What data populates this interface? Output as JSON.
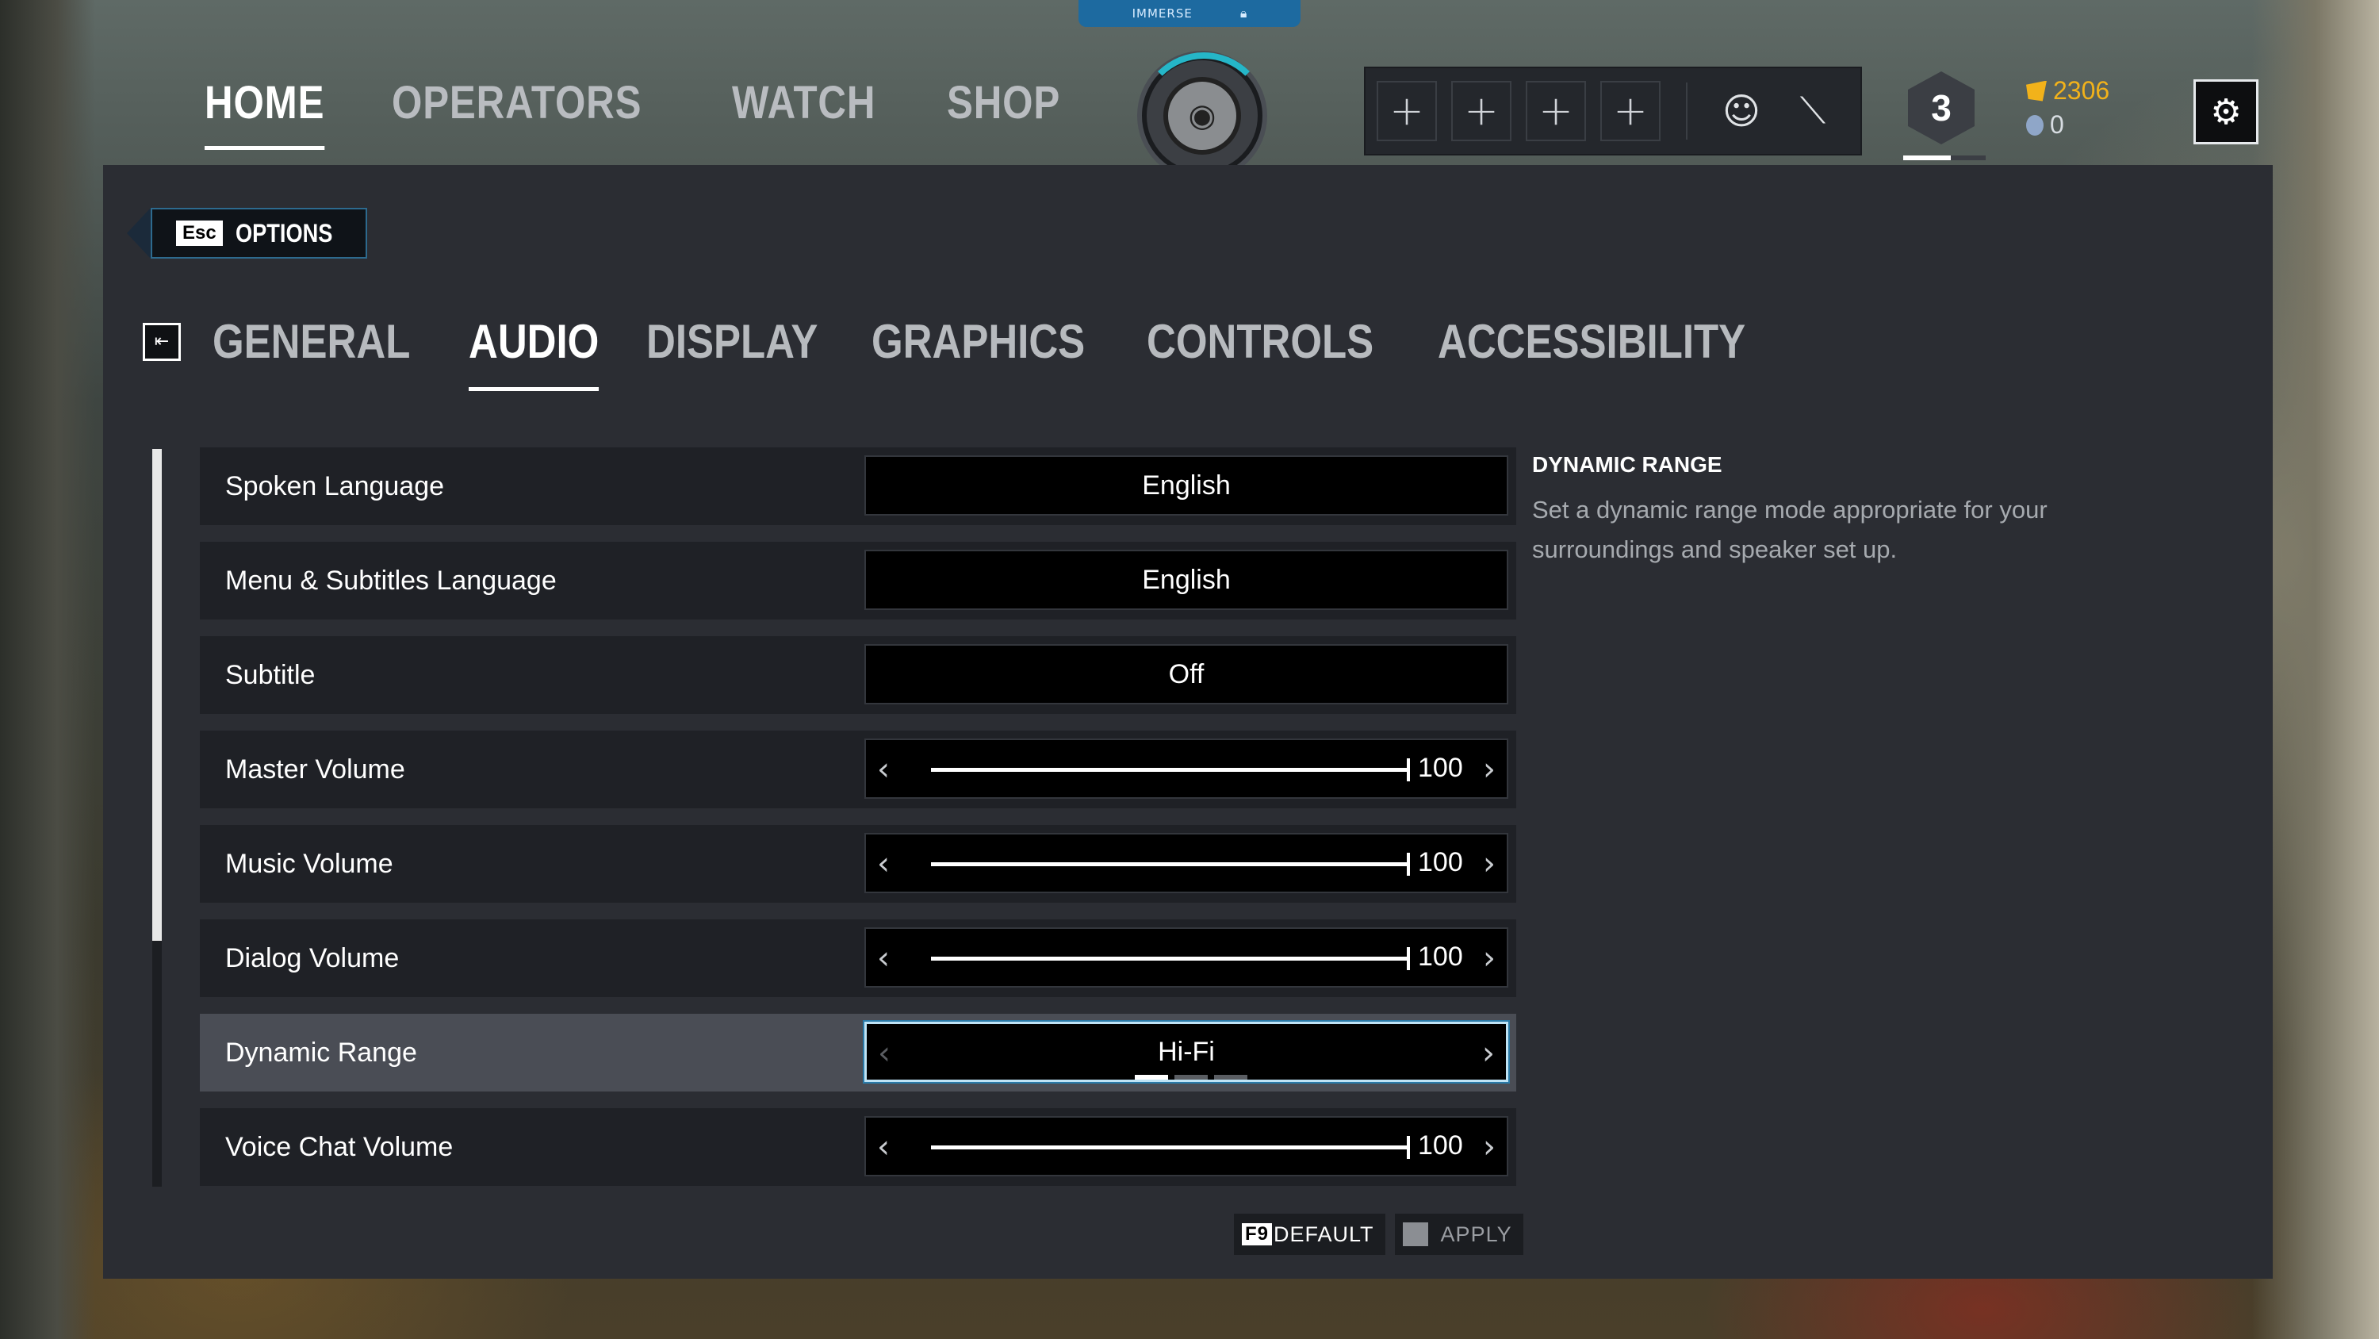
{
  "window": {
    "tag_label": "IMMERSE"
  },
  "nav": {
    "items": [
      "HOME",
      "OPERATORS",
      "WATCH",
      "SHOP"
    ],
    "active": "HOME"
  },
  "profile": {
    "rank": "3",
    "rank_progress_fraction": 0.58,
    "credits_gold": "2306",
    "credits_silver": "0"
  },
  "squad": {
    "slots": [
      "+",
      "+",
      "+",
      "+"
    ]
  },
  "back": {
    "key": "Esc",
    "label": "OPTIONS"
  },
  "tabs": {
    "items": [
      "GENERAL",
      "AUDIO",
      "DISPLAY",
      "GRAPHICS",
      "CONTROLS",
      "ACCESSIBILITY"
    ],
    "active": "AUDIO"
  },
  "settings": {
    "spoken_language": {
      "label": "Spoken Language",
      "value": "English"
    },
    "menu_language": {
      "label": "Menu & Subtitles Language",
      "value": "English"
    },
    "subtitle": {
      "label": "Subtitle",
      "value": "Off"
    },
    "master_volume": {
      "label": "Master Volume",
      "value": "100",
      "display": "100"
    },
    "music_volume": {
      "label": "Music Volume",
      "value": "100",
      "display": "100"
    },
    "dialog_volume": {
      "label": "Dialog Volume",
      "value": "100",
      "display": "100"
    },
    "dynamic_range": {
      "label": "Dynamic Range",
      "value": "Hi-Fi",
      "options_count": 3,
      "selected_index": 0
    },
    "voice_chat_volume": {
      "label": "Voice Chat Volume",
      "value": "100",
      "display": "100"
    }
  },
  "description": {
    "title": "DYNAMIC RANGE",
    "body": "Set a dynamic range mode appropriate for your surroundings and speaker set up."
  },
  "footer": {
    "default_key": "F9",
    "default_label": "DEFAULT",
    "apply_label": "APPLY"
  },
  "colors": {
    "accent_blue": "#2a7aa8",
    "gold": "#f2b21a",
    "panel": "#2b2d33"
  }
}
